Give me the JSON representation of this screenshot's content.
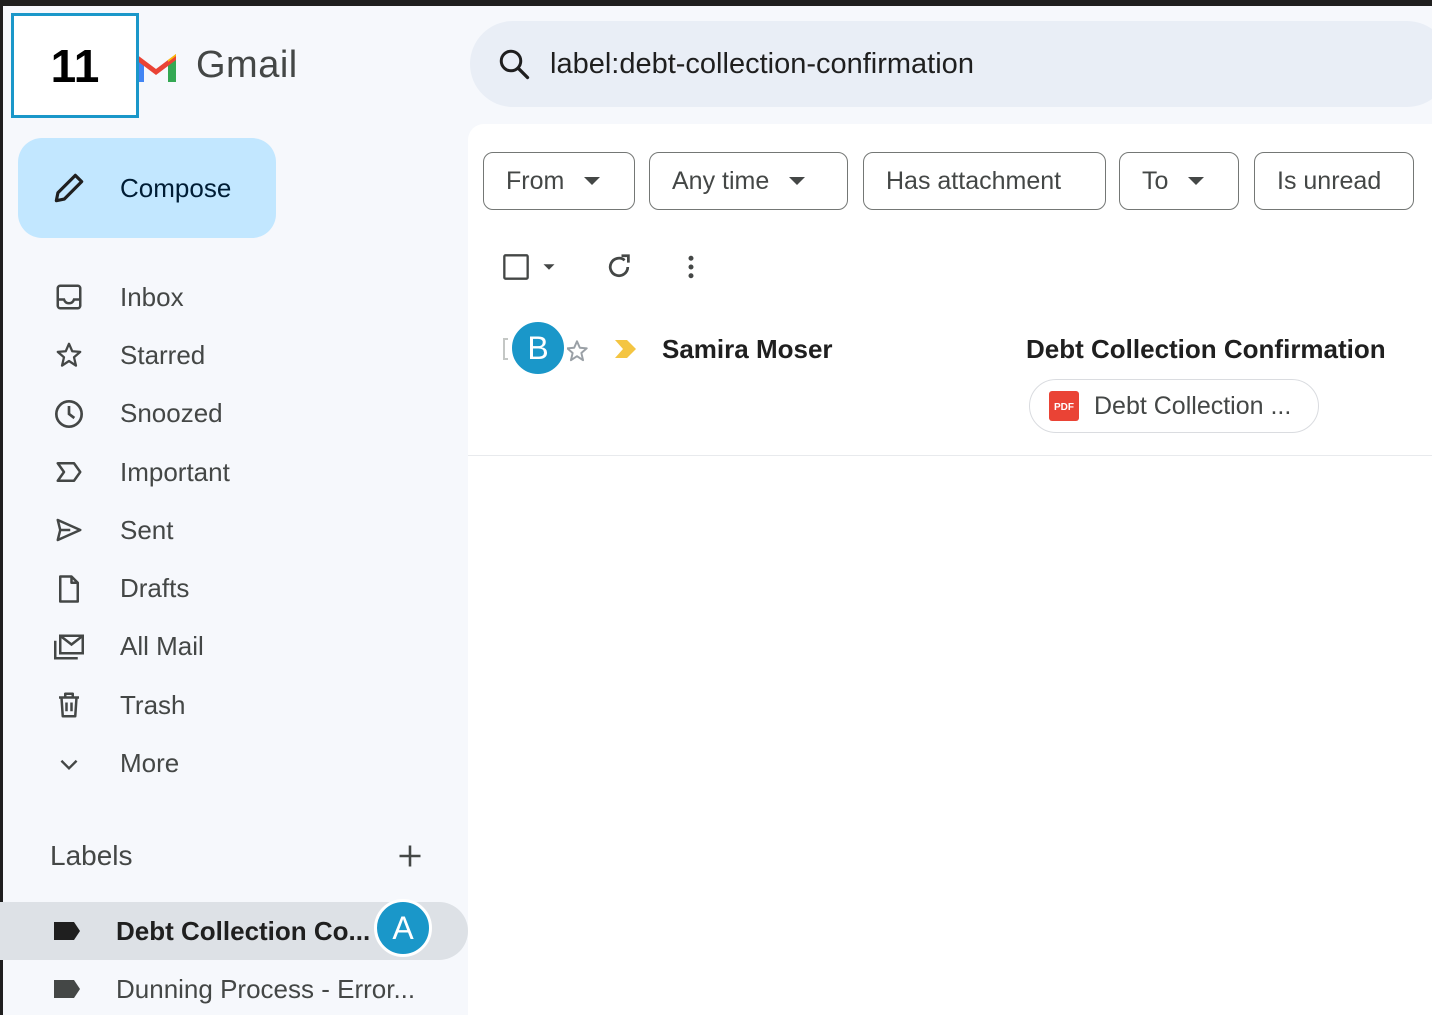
{
  "step_number": "11",
  "app": {
    "name": "Gmail"
  },
  "search": {
    "query": "label:debt-collection-confirmation"
  },
  "compose": {
    "label": "Compose"
  },
  "nav": [
    {
      "label": "Inbox",
      "icon": "inbox-icon"
    },
    {
      "label": "Starred",
      "icon": "star-icon"
    },
    {
      "label": "Snoozed",
      "icon": "clock-icon"
    },
    {
      "label": "Important",
      "icon": "important-icon"
    },
    {
      "label": "Sent",
      "icon": "send-icon"
    },
    {
      "label": "Drafts",
      "icon": "draft-icon"
    },
    {
      "label": "All Mail",
      "icon": "all-mail-icon"
    },
    {
      "label": "Trash",
      "icon": "trash-icon"
    },
    {
      "label": "More",
      "icon": "chevron-down-icon"
    }
  ],
  "labels": {
    "title": "Labels",
    "items": [
      {
        "label": "Debt Collection Co...",
        "active": true
      },
      {
        "label": "Dunning Process - Error...",
        "active": false
      }
    ]
  },
  "filters": [
    "From",
    "Any time",
    "Has attachment",
    "To",
    "Is unread"
  ],
  "emails": [
    {
      "sender": "Samira Moser",
      "subject": "Debt Collection Confirmation",
      "attachment": "Debt Collection ...",
      "attachment_type": "PDF"
    }
  ],
  "markers": {
    "a": "A",
    "b": "B"
  },
  "colors": {
    "accent": "#1a97c9",
    "compose_bg": "#c2e7ff",
    "pdf_red": "#ea4335",
    "important_yellow": "#f4c542"
  }
}
